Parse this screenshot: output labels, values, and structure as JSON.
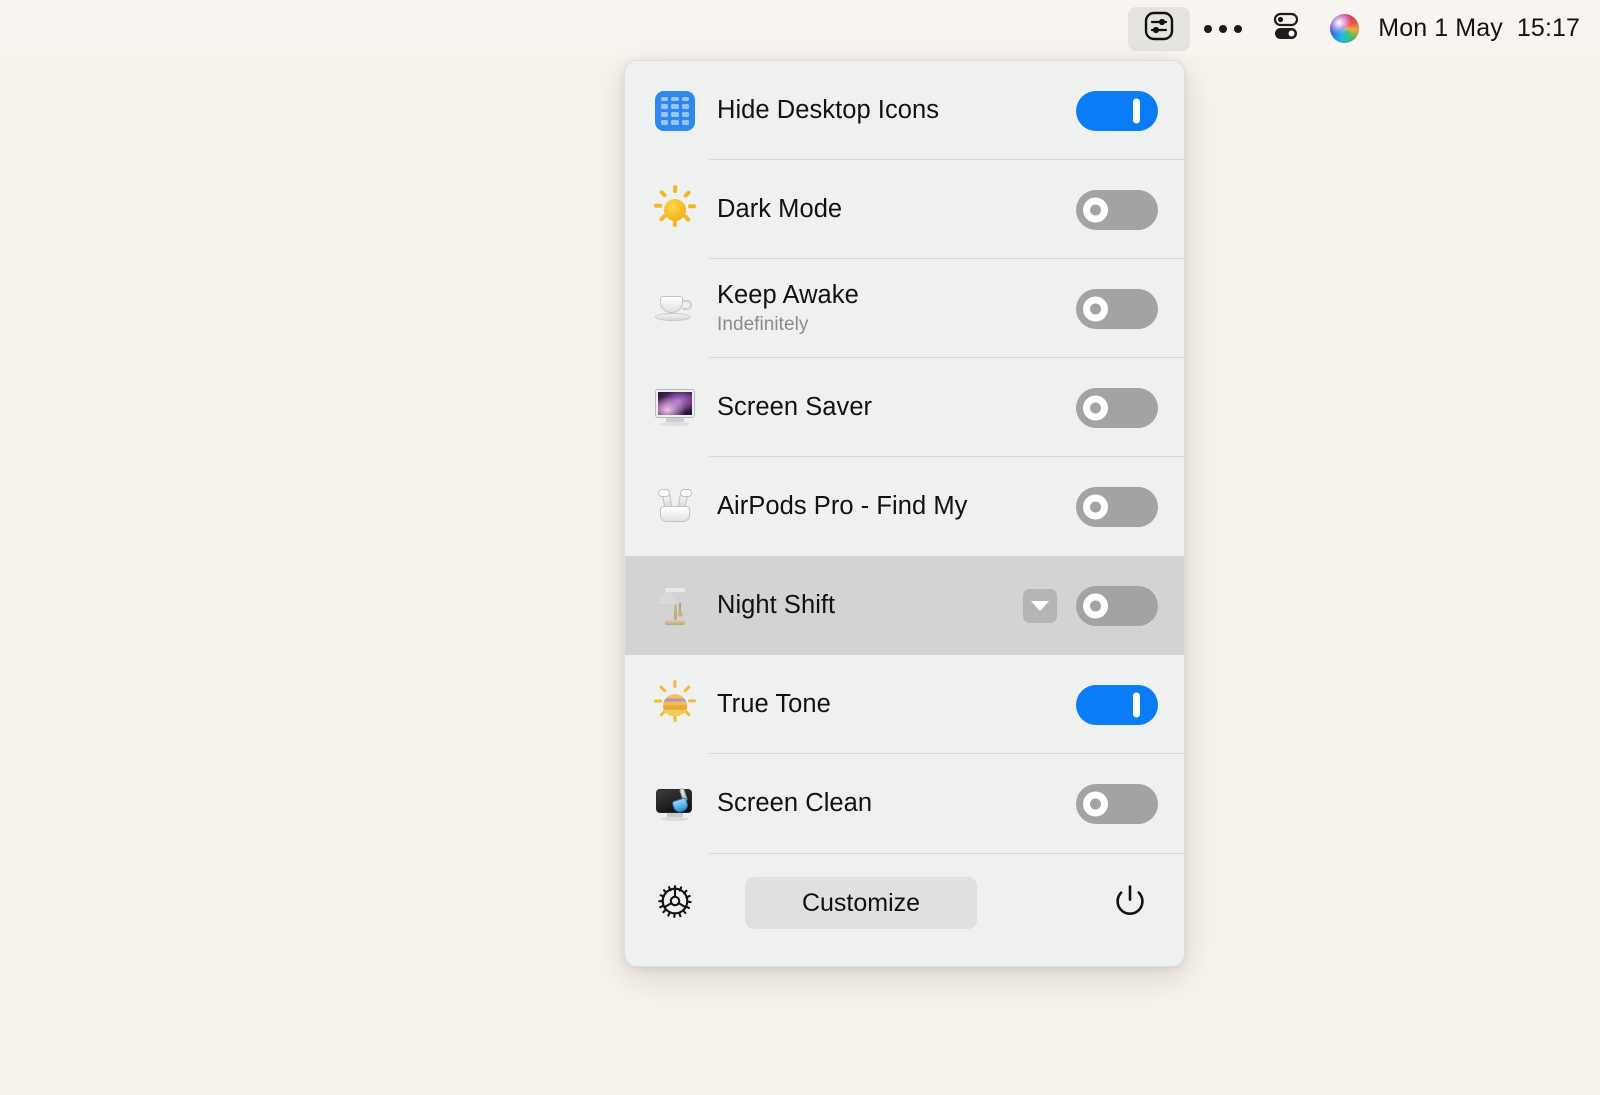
{
  "menubar": {
    "app_icon": "sliders-square-icon",
    "more_icon": "ellipsis-icon",
    "control_center_icon": "control-center-icon",
    "siri_icon": "siri-orb-icon",
    "clock": "Mon 1 May  15:17"
  },
  "panel": {
    "rows": [
      {
        "icon": "desktop-grid-icon",
        "title": "Hide Desktop Icons",
        "subtitle": "",
        "toggle": "on",
        "has_chevron": false,
        "highlighted": false
      },
      {
        "icon": "sun-icon",
        "title": "Dark Mode",
        "subtitle": "",
        "toggle": "off",
        "has_chevron": false,
        "highlighted": false
      },
      {
        "icon": "coffee-cup-icon",
        "title": "Keep Awake",
        "subtitle": "Indefinitely",
        "toggle": "off",
        "has_chevron": false,
        "highlighted": false
      },
      {
        "icon": "screen-saver-monitor-icon",
        "title": "Screen Saver",
        "subtitle": "",
        "toggle": "off",
        "has_chevron": false,
        "highlighted": false
      },
      {
        "icon": "airpods-case-icon",
        "title": "AirPods Pro - Find My",
        "subtitle": "",
        "toggle": "off",
        "has_chevron": false,
        "highlighted": false
      },
      {
        "icon": "desk-lamp-icon",
        "title": "Night Shift",
        "subtitle": "",
        "toggle": "off",
        "has_chevron": true,
        "highlighted": true
      },
      {
        "icon": "true-tone-sun-icon",
        "title": "True Tone",
        "subtitle": "",
        "toggle": "on",
        "has_chevron": false,
        "highlighted": false
      },
      {
        "icon": "screen-clean-brush-icon",
        "title": "Screen Clean",
        "subtitle": "",
        "toggle": "off",
        "has_chevron": false,
        "highlighted": false
      }
    ],
    "footer": {
      "settings_icon": "gear-icon",
      "customize_label": "Customize",
      "power_icon": "power-icon"
    }
  },
  "colors": {
    "desktop_background": "#F7F2EC",
    "panel_background": "#EFF0F0",
    "toggle_on": "#0A7CF5",
    "toggle_off": "#A3A3A3",
    "row_highlight": "#D3D3D3",
    "customize_button": "#E0E0E0"
  }
}
